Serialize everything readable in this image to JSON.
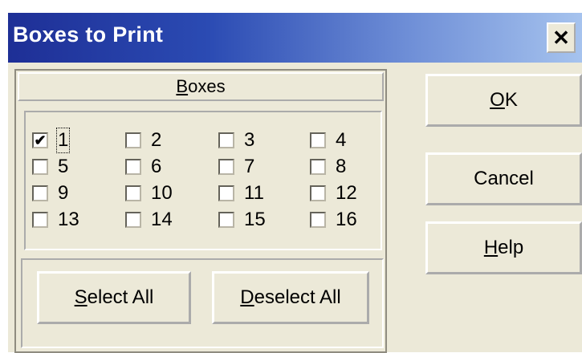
{
  "window": {
    "title": "Boxes to Print"
  },
  "title_bar": {
    "close_icon": "close-icon",
    "close_glyph": "✕"
  },
  "boxes_group": {
    "header": {
      "mnemonic": "B",
      "rest": "oxes"
    },
    "items": [
      {
        "label": "1",
        "checked": true
      },
      {
        "label": "2",
        "checked": false
      },
      {
        "label": "3",
        "checked": false
      },
      {
        "label": "4",
        "checked": false
      },
      {
        "label": "5",
        "checked": false
      },
      {
        "label": "6",
        "checked": false
      },
      {
        "label": "7",
        "checked": false
      },
      {
        "label": "8",
        "checked": false
      },
      {
        "label": "9",
        "checked": false
      },
      {
        "label": "10",
        "checked": false
      },
      {
        "label": "11",
        "checked": false
      },
      {
        "label": "12",
        "checked": false
      },
      {
        "label": "13",
        "checked": false
      },
      {
        "label": "14",
        "checked": false
      },
      {
        "label": "15",
        "checked": false
      },
      {
        "label": "16",
        "checked": false
      }
    ],
    "check_glyph": "✔",
    "select_all": {
      "mnemonic": "S",
      "rest": "elect All"
    },
    "deselect_all": {
      "mnemonic": "D",
      "rest": "eselect All"
    }
  },
  "actions": {
    "ok": {
      "mnemonic": "O",
      "rest": "K"
    },
    "cancel": {
      "label": "Cancel"
    },
    "help": {
      "mnemonic": "H",
      "rest": "elp"
    }
  },
  "colors": {
    "titlebar_start": "#1e2f96",
    "titlebar_end": "#a6c3ee",
    "dialog_bg": "#ece9d8"
  }
}
